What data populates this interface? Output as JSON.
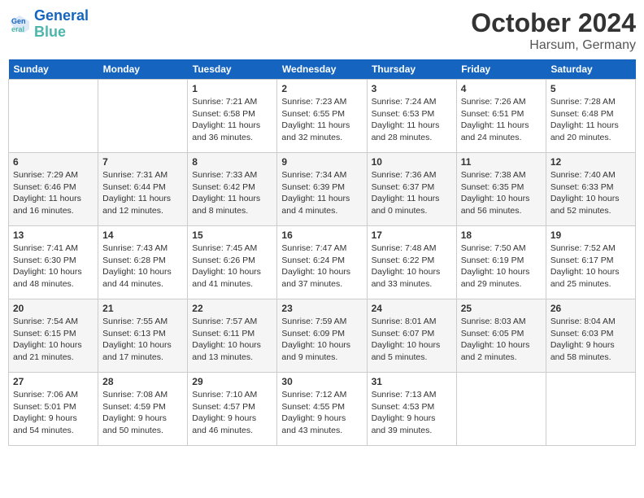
{
  "header": {
    "logo_line1": "General",
    "logo_line2": "Blue",
    "month_title": "October 2024",
    "location": "Harsum, Germany"
  },
  "weekdays": [
    "Sunday",
    "Monday",
    "Tuesday",
    "Wednesday",
    "Thursday",
    "Friday",
    "Saturday"
  ],
  "weeks": [
    [
      {
        "day": "",
        "sunrise": "",
        "sunset": "",
        "daylight": ""
      },
      {
        "day": "",
        "sunrise": "",
        "sunset": "",
        "daylight": ""
      },
      {
        "day": "1",
        "sunrise": "Sunrise: 7:21 AM",
        "sunset": "Sunset: 6:58 PM",
        "daylight": "Daylight: 11 hours and 36 minutes."
      },
      {
        "day": "2",
        "sunrise": "Sunrise: 7:23 AM",
        "sunset": "Sunset: 6:55 PM",
        "daylight": "Daylight: 11 hours and 32 minutes."
      },
      {
        "day": "3",
        "sunrise": "Sunrise: 7:24 AM",
        "sunset": "Sunset: 6:53 PM",
        "daylight": "Daylight: 11 hours and 28 minutes."
      },
      {
        "day": "4",
        "sunrise": "Sunrise: 7:26 AM",
        "sunset": "Sunset: 6:51 PM",
        "daylight": "Daylight: 11 hours and 24 minutes."
      },
      {
        "day": "5",
        "sunrise": "Sunrise: 7:28 AM",
        "sunset": "Sunset: 6:48 PM",
        "daylight": "Daylight: 11 hours and 20 minutes."
      }
    ],
    [
      {
        "day": "6",
        "sunrise": "Sunrise: 7:29 AM",
        "sunset": "Sunset: 6:46 PM",
        "daylight": "Daylight: 11 hours and 16 minutes."
      },
      {
        "day": "7",
        "sunrise": "Sunrise: 7:31 AM",
        "sunset": "Sunset: 6:44 PM",
        "daylight": "Daylight: 11 hours and 12 minutes."
      },
      {
        "day": "8",
        "sunrise": "Sunrise: 7:33 AM",
        "sunset": "Sunset: 6:42 PM",
        "daylight": "Daylight: 11 hours and 8 minutes."
      },
      {
        "day": "9",
        "sunrise": "Sunrise: 7:34 AM",
        "sunset": "Sunset: 6:39 PM",
        "daylight": "Daylight: 11 hours and 4 minutes."
      },
      {
        "day": "10",
        "sunrise": "Sunrise: 7:36 AM",
        "sunset": "Sunset: 6:37 PM",
        "daylight": "Daylight: 11 hours and 0 minutes."
      },
      {
        "day": "11",
        "sunrise": "Sunrise: 7:38 AM",
        "sunset": "Sunset: 6:35 PM",
        "daylight": "Daylight: 10 hours and 56 minutes."
      },
      {
        "day": "12",
        "sunrise": "Sunrise: 7:40 AM",
        "sunset": "Sunset: 6:33 PM",
        "daylight": "Daylight: 10 hours and 52 minutes."
      }
    ],
    [
      {
        "day": "13",
        "sunrise": "Sunrise: 7:41 AM",
        "sunset": "Sunset: 6:30 PM",
        "daylight": "Daylight: 10 hours and 48 minutes."
      },
      {
        "day": "14",
        "sunrise": "Sunrise: 7:43 AM",
        "sunset": "Sunset: 6:28 PM",
        "daylight": "Daylight: 10 hours and 44 minutes."
      },
      {
        "day": "15",
        "sunrise": "Sunrise: 7:45 AM",
        "sunset": "Sunset: 6:26 PM",
        "daylight": "Daylight: 10 hours and 41 minutes."
      },
      {
        "day": "16",
        "sunrise": "Sunrise: 7:47 AM",
        "sunset": "Sunset: 6:24 PM",
        "daylight": "Daylight: 10 hours and 37 minutes."
      },
      {
        "day": "17",
        "sunrise": "Sunrise: 7:48 AM",
        "sunset": "Sunset: 6:22 PM",
        "daylight": "Daylight: 10 hours and 33 minutes."
      },
      {
        "day": "18",
        "sunrise": "Sunrise: 7:50 AM",
        "sunset": "Sunset: 6:19 PM",
        "daylight": "Daylight: 10 hours and 29 minutes."
      },
      {
        "day": "19",
        "sunrise": "Sunrise: 7:52 AM",
        "sunset": "Sunset: 6:17 PM",
        "daylight": "Daylight: 10 hours and 25 minutes."
      }
    ],
    [
      {
        "day": "20",
        "sunrise": "Sunrise: 7:54 AM",
        "sunset": "Sunset: 6:15 PM",
        "daylight": "Daylight: 10 hours and 21 minutes."
      },
      {
        "day": "21",
        "sunrise": "Sunrise: 7:55 AM",
        "sunset": "Sunset: 6:13 PM",
        "daylight": "Daylight: 10 hours and 17 minutes."
      },
      {
        "day": "22",
        "sunrise": "Sunrise: 7:57 AM",
        "sunset": "Sunset: 6:11 PM",
        "daylight": "Daylight: 10 hours and 13 minutes."
      },
      {
        "day": "23",
        "sunrise": "Sunrise: 7:59 AM",
        "sunset": "Sunset: 6:09 PM",
        "daylight": "Daylight: 10 hours and 9 minutes."
      },
      {
        "day": "24",
        "sunrise": "Sunrise: 8:01 AM",
        "sunset": "Sunset: 6:07 PM",
        "daylight": "Daylight: 10 hours and 5 minutes."
      },
      {
        "day": "25",
        "sunrise": "Sunrise: 8:03 AM",
        "sunset": "Sunset: 6:05 PM",
        "daylight": "Daylight: 10 hours and 2 minutes."
      },
      {
        "day": "26",
        "sunrise": "Sunrise: 8:04 AM",
        "sunset": "Sunset: 6:03 PM",
        "daylight": "Daylight: 9 hours and 58 minutes."
      }
    ],
    [
      {
        "day": "27",
        "sunrise": "Sunrise: 7:06 AM",
        "sunset": "Sunset: 5:01 PM",
        "daylight": "Daylight: 9 hours and 54 minutes."
      },
      {
        "day": "28",
        "sunrise": "Sunrise: 7:08 AM",
        "sunset": "Sunset: 4:59 PM",
        "daylight": "Daylight: 9 hours and 50 minutes."
      },
      {
        "day": "29",
        "sunrise": "Sunrise: 7:10 AM",
        "sunset": "Sunset: 4:57 PM",
        "daylight": "Daylight: 9 hours and 46 minutes."
      },
      {
        "day": "30",
        "sunrise": "Sunrise: 7:12 AM",
        "sunset": "Sunset: 4:55 PM",
        "daylight": "Daylight: 9 hours and 43 minutes."
      },
      {
        "day": "31",
        "sunrise": "Sunrise: 7:13 AM",
        "sunset": "Sunset: 4:53 PM",
        "daylight": "Daylight: 9 hours and 39 minutes."
      },
      {
        "day": "",
        "sunrise": "",
        "sunset": "",
        "daylight": ""
      },
      {
        "day": "",
        "sunrise": "",
        "sunset": "",
        "daylight": ""
      }
    ]
  ]
}
